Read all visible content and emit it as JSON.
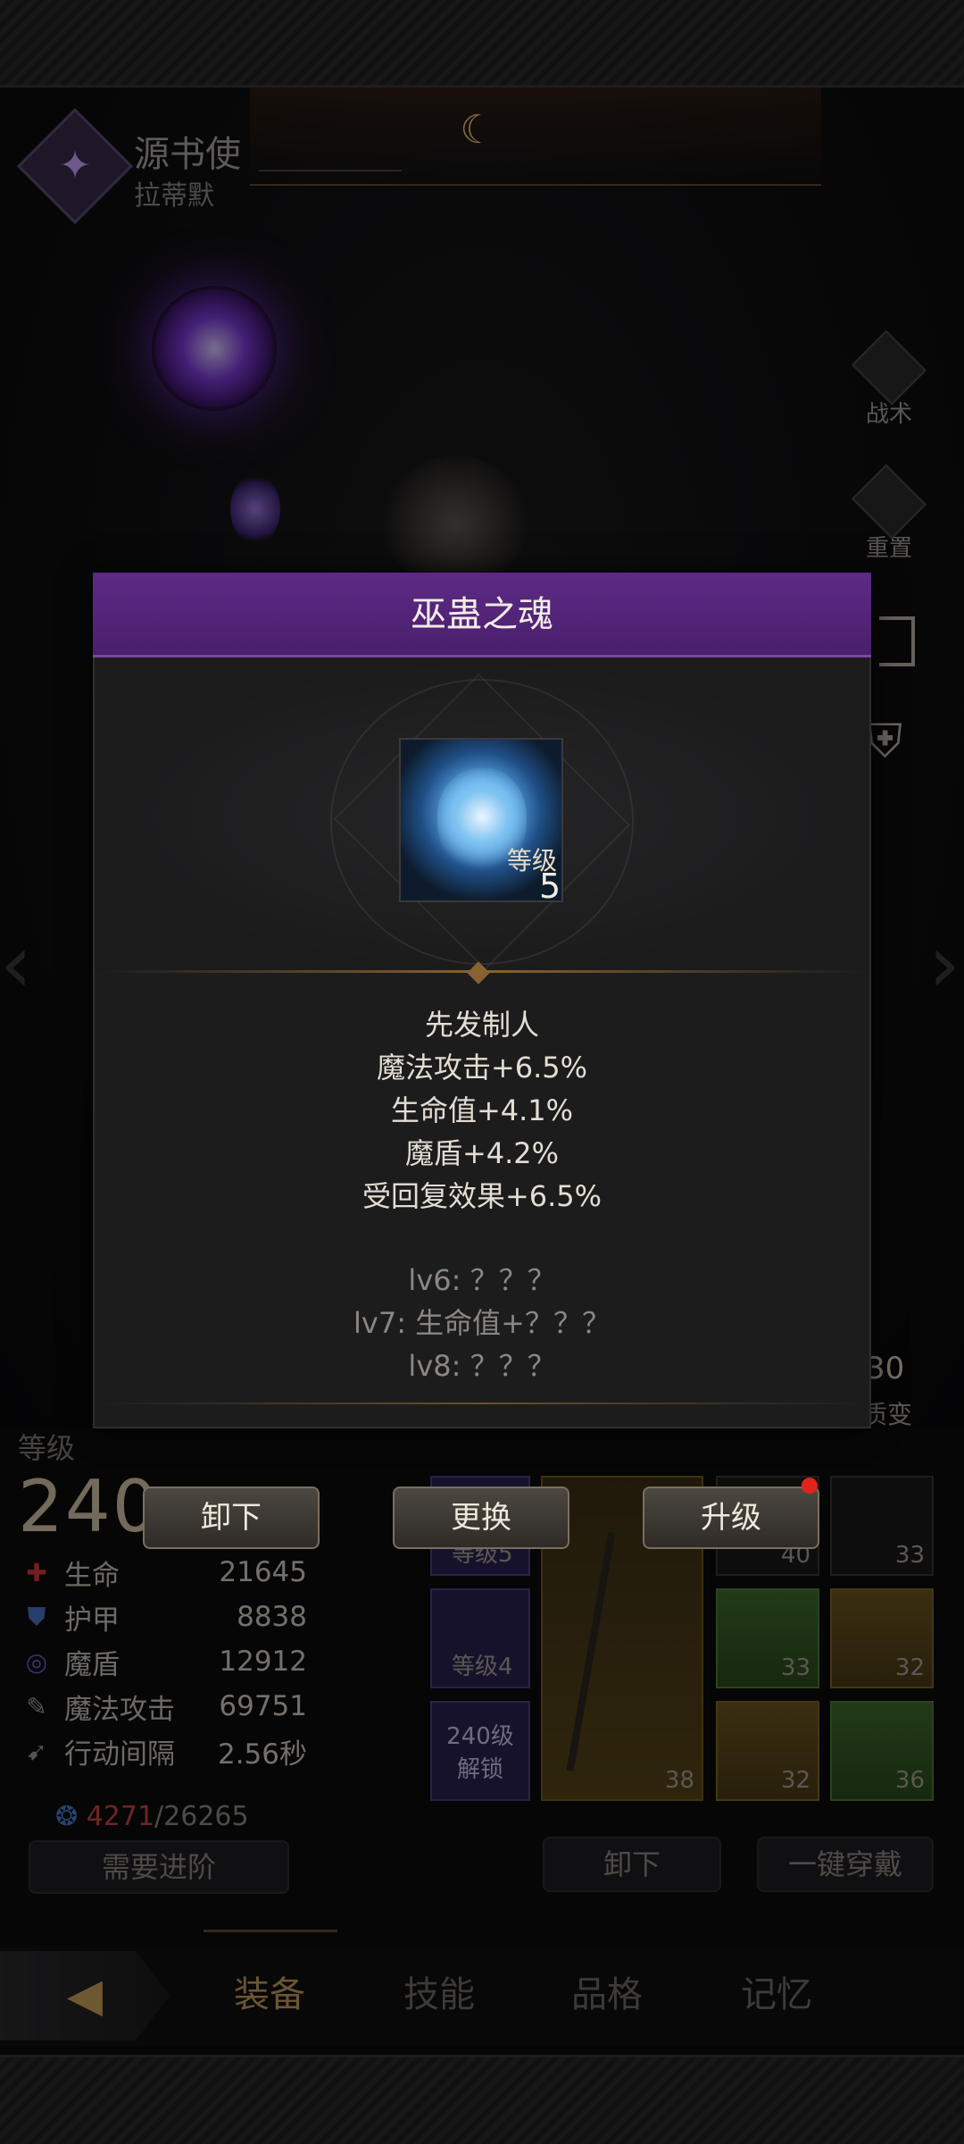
{
  "hero": {
    "class_title": "源书使",
    "class_name": "拉蒂默"
  },
  "side_menu": [
    {
      "label": "战术",
      "icon": "banner-icon"
    },
    {
      "label": "重置",
      "icon": "helmet-icon"
    }
  ],
  "transform": {
    "value": "30",
    "label": "质变"
  },
  "stats_panel": {
    "level_label": "等级",
    "level_value": "240",
    "stats": [
      {
        "icon": "cross-icon",
        "name": "生命",
        "value": "21645",
        "color": "#d23a3a"
      },
      {
        "icon": "shield-icon",
        "name": "护甲",
        "value": "8838",
        "color": "#4a6fc0"
      },
      {
        "icon": "swirl-icon",
        "name": "魔盾",
        "value": "12912",
        "color": "#7b55c9"
      },
      {
        "icon": "wand-icon",
        "name": "魔法攻击",
        "value": "69751",
        "color": "#9a9a9a"
      },
      {
        "icon": "wing-icon",
        "name": "行动间隔",
        "value": "2.56秒",
        "color": "#9a9a9a"
      }
    ],
    "souls_current": "4271",
    "souls_separator": "/",
    "souls_total": "26265",
    "need_advance_label": "需要进阶"
  },
  "equipment": {
    "soul_slots": [
      {
        "label": "等级5"
      },
      {
        "label": "等级4"
      },
      {
        "label": "240级\n解锁"
      }
    ],
    "weapon_level": "38",
    "gear_levels": [
      "40",
      "33",
      "33",
      "32",
      "32",
      "36"
    ],
    "unequip_all_label": "卸下",
    "equip_all_label": "一键穿戴"
  },
  "tabs": [
    {
      "label": "装备",
      "active": true
    },
    {
      "label": "技能",
      "active": false
    },
    {
      "label": "品格",
      "active": false
    },
    {
      "label": "记忆",
      "active": false
    }
  ],
  "modal": {
    "title": "巫蛊之魂",
    "soul_level_label": "等级",
    "soul_level_value": "5",
    "description": [
      "先发制人",
      "魔法攻击+6.5%",
      "生命值+4.1%",
      "魔盾+4.2%",
      "受回复效果+6.5%"
    ],
    "locked_bonuses": [
      "lv6: ？？？",
      "lv7: 生命值+？？？",
      "lv8: ？？？"
    ],
    "actions": {
      "unequip": "卸下",
      "replace": "更换",
      "upgrade": "升级"
    },
    "header_color": "#5d2a86"
  }
}
